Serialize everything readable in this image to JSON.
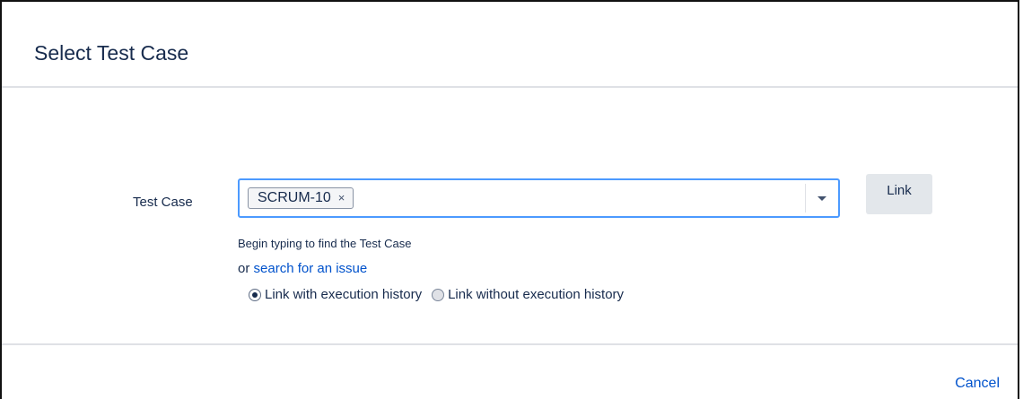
{
  "dialog": {
    "title": "Select Test Case"
  },
  "form": {
    "field_label": "Test Case",
    "selected_chip": "SCRUM-10",
    "chip_remove": "×",
    "link_button": "Link",
    "hint": "Begin typing to find the Test Case",
    "search_prefix": "or ",
    "search_link": "search for an issue",
    "radio_options": [
      {
        "label": "Link with execution history",
        "checked": true
      },
      {
        "label": "Link without execution history",
        "checked": false
      }
    ]
  },
  "footer": {
    "cancel": "Cancel"
  },
  "icons": {
    "dropdown": "chevron-down-icon",
    "chip_remove": "close-icon"
  },
  "colors": {
    "focus_border": "#4c9aff",
    "link": "#0052cc",
    "button_bg": "#e3e7eb",
    "text": "#172b4d"
  }
}
